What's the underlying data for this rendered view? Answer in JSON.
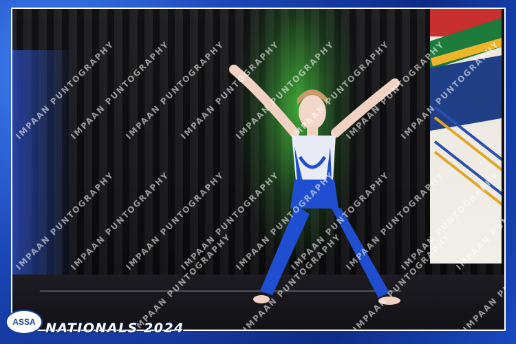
{
  "photo": {
    "subject": "gymnast",
    "watermark_text": "IMPAAN PUNTOGRAPHY",
    "event_title": "NATIONALS 2024",
    "logo_text": "ASSA"
  },
  "colors": {
    "frame_blue": "#1b47b8",
    "stage_green": "#46be3c",
    "leotard_blue": "#1f4fd0",
    "leotard_white": "#e9ecf6"
  }
}
